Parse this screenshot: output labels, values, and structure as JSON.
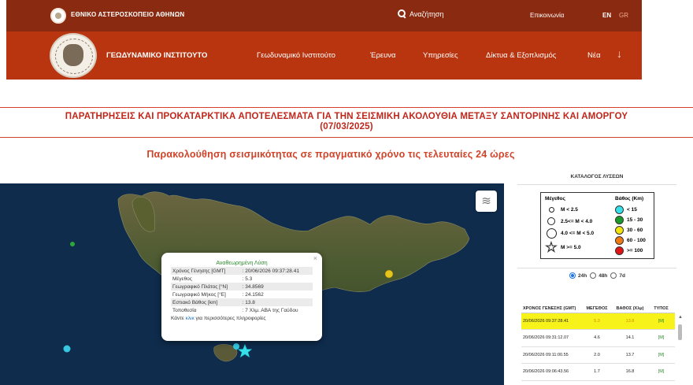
{
  "header": {
    "observatory": "ΕΘΝΙΚΟ ΑΣΤΕΡΟΣΚΟΠΕΙΟ ΑΘΗΝΩΝ",
    "search_label": "Αναζήτηση",
    "contact": "Επικοινωνία",
    "lang_en": "EN",
    "lang_gr": "GR",
    "institute": "ΓΕΩΔΥΝΑΜΙΚΟ ΙΝΣΤΙΤΟΥΤΟ",
    "nav": [
      "Γεωδυναμικό Ινστιτούτο",
      "Έρευνα",
      "Υπηρεσίες",
      "Δίκτυα & Εξοπλισμός",
      "Νέα"
    ],
    "down_arrow": "↓"
  },
  "page": {
    "title_line1": "ΠΑΡΑΤΗΡΗΣΕΙΣ ΚΑΙ ΠΡΟΚΑΤΑΡΚΤΙΚΑ ΑΠΟΤΕΛΕΣΜΑΤΑ ΓΙΑ ΤΗΝ ΣΕΙΣΜΙΚΗ ΑΚΟΛΟΥΘΙΑ ΜΕΤΑΞΥ ΣΑΝΤΟΡΙΝΗΣ ΚΑΙ ΑΜΟΡΓΟΥ",
    "title_line2": "(07/03/2025)",
    "subtitle": "Παρακολούθηση σεισμικότητας σε πραγματικό χρόνο τις τελευταίες 24 ώρες"
  },
  "popup": {
    "title": "Αναθεωρημένη Λύση",
    "close": "×",
    "rows": [
      {
        "label": "Χρόνος Γένησης [GMT]",
        "value": ": 20/06/2026 09:37:28.41"
      },
      {
        "label": "Μέγεθος",
        "value": ": 5.3"
      },
      {
        "label": "Γεωγραφικό Πλάτος [°N]",
        "value": ": 34.8569"
      },
      {
        "label": "Γεωγραφικό Μήκος [°E]",
        "value": ": 24.1562"
      },
      {
        "label": "Εστιακό Βάθος [km]",
        "value": ": 13.8"
      },
      {
        "label": "Τοποθεσία",
        "value": ": 7 Χλμ. ΑΒΑ της Γαύδου"
      }
    ],
    "click_pre": "Κάντε ",
    "click_link": "κλικ",
    "click_post": " για περισσότερες πληροφορίες"
  },
  "legend": {
    "catalog_title": "ΚΑΤΑΛΟΓΟΣ ΛΥΣΕΩΝ",
    "magnitude_header": "Μέγεθος",
    "depth_header": "Βάθος (Km)",
    "magnitudes": [
      "M < 2.5",
      "2.5<= M < 4.0",
      "4.0 <= M < 5.0",
      "M >= 5.0"
    ],
    "depths": [
      {
        "label": "< 15",
        "color": "#36e0e8"
      },
      {
        "label": "15 - 30",
        "color": "#1a9a2a"
      },
      {
        "label": "30 - 60",
        "color": "#f2e30c"
      },
      {
        "label": "60 - 100",
        "color": "#f07a12"
      },
      {
        "label": ">= 100",
        "color": "#e01414"
      }
    ]
  },
  "filters": {
    "options": [
      "24h",
      "48h",
      "7d"
    ],
    "selected": "24h"
  },
  "events_table": {
    "headers": [
      "ΧΡΟΝΟΣ ΓΕΝΕΣΗΣ (GMT)",
      "ΜΕΓΕΘΟΣ",
      "ΒΑΘΟΣ (Χλμ)",
      "ΤΥΠΟΣ"
    ],
    "rows": [
      {
        "time": "20/06/2026 09:37:28.41",
        "mag": "5.3",
        "depth": "13.8",
        "type": "[M]"
      },
      {
        "time": "20/06/2026 09:31:12.07",
        "mag": "4.6",
        "depth": "14.1",
        "type": "[M]"
      },
      {
        "time": "20/06/2026 09:11:00.55",
        "mag": "2.0",
        "depth": "13.7",
        "type": "[M]"
      },
      {
        "time": "20/06/2026 09:06:43.56",
        "mag": "1.7",
        "depth": "16.8",
        "type": "[M]"
      }
    ]
  },
  "map": {
    "layers_icon": "layers-icon",
    "colors": {
      "sea": "#0f2c4d",
      "land": "#5a5a3a",
      "star": "#36e0e8"
    }
  }
}
